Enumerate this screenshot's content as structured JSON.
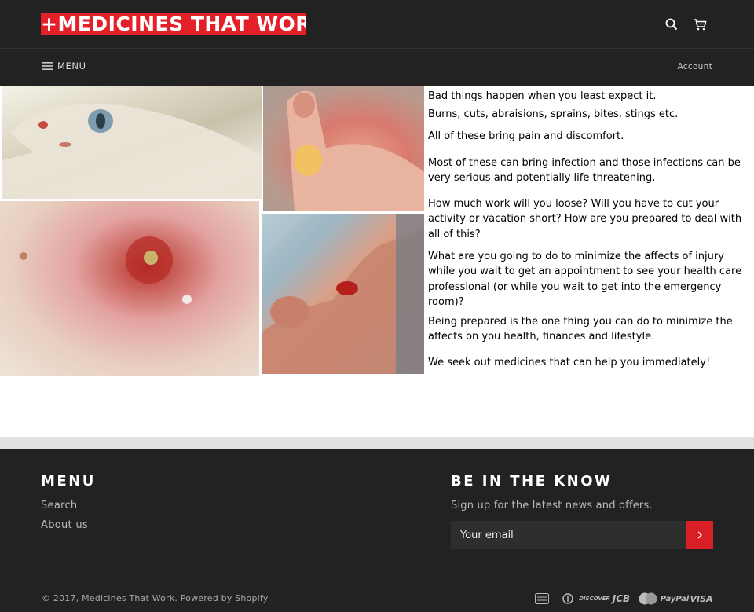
{
  "header": {
    "logo_text": "+MEDICINES THAT WORK+",
    "menu_label": "MENU",
    "account_label": "Account",
    "search_icon": "search-icon",
    "cart_icon": "cart-icon"
  },
  "hero": {
    "paragraphs": [
      "Bad things happen when you least expect it.",
      "Burns, cuts, abraisions, sprains, bites, stings etc.",
      "All of these bring pain and discomfort.",
      "Most of these can bring infection and those infections can be very serious and potentially life threatening.",
      "How much work will you loose? Will you have to cut your activity or vacation short? How are you prepared to deal with all of this?",
      "What are you going to do to minimize the affects of injury while you wait to get an appointment to see your health care professional (or while you wait to get into the emergency room)?",
      "Being prepared is the one thing you can do to minimize the affects on you health, finances and lifestyle.",
      "We seek out medicines that can help you immediately!"
    ]
  },
  "footer": {
    "menu_heading": "MENU",
    "links": [
      "Search",
      "About us"
    ],
    "newsletter_heading": "BE IN THE KNOW",
    "newsletter_sub": "Sign up for the latest news and offers.",
    "email_placeholder": "Your email",
    "copyright": "© 2017, Medicines That Work. Powered by Shopify",
    "payments": [
      "AMEX",
      "Diners",
      "DISCOVER",
      "JCB",
      "MasterCard",
      "PayPal",
      "VISA"
    ]
  },
  "colors": {
    "brand_red": "#e32028",
    "dark_bg": "#222222"
  }
}
